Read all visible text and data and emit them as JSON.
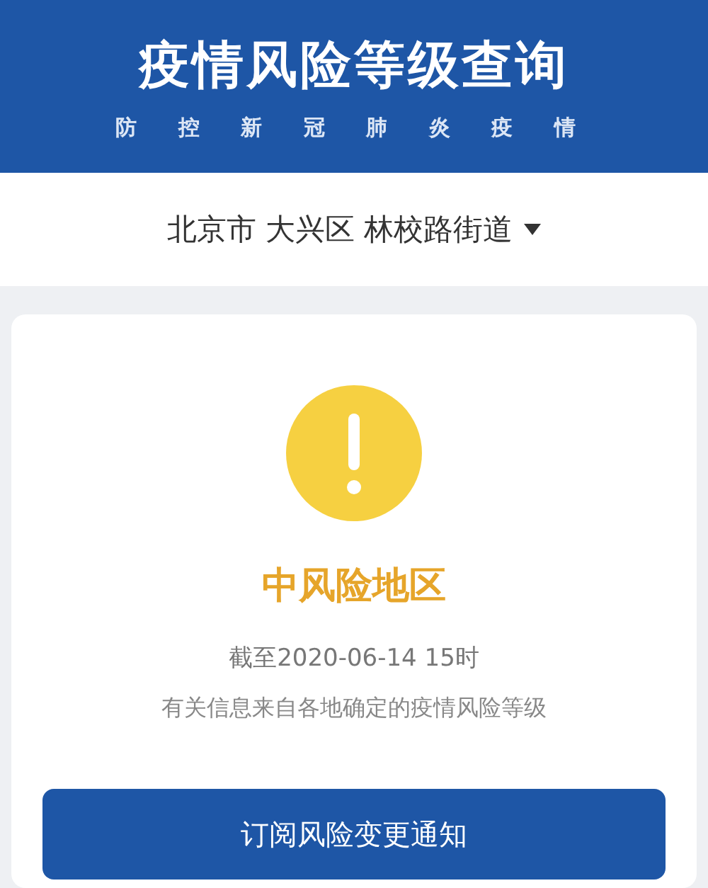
{
  "header": {
    "title": "疫情风险等级查询",
    "subtitle": "防 控 新 冠 肺 炎 疫 情"
  },
  "location": {
    "text": "北京市 大兴区 林校路街道"
  },
  "result": {
    "level": "中风险地区",
    "updated": "截至2020-06-14 15时",
    "source": "有关信息来自各地确定的疫情风险等级"
  },
  "button": {
    "label": "订阅风险变更通知"
  }
}
